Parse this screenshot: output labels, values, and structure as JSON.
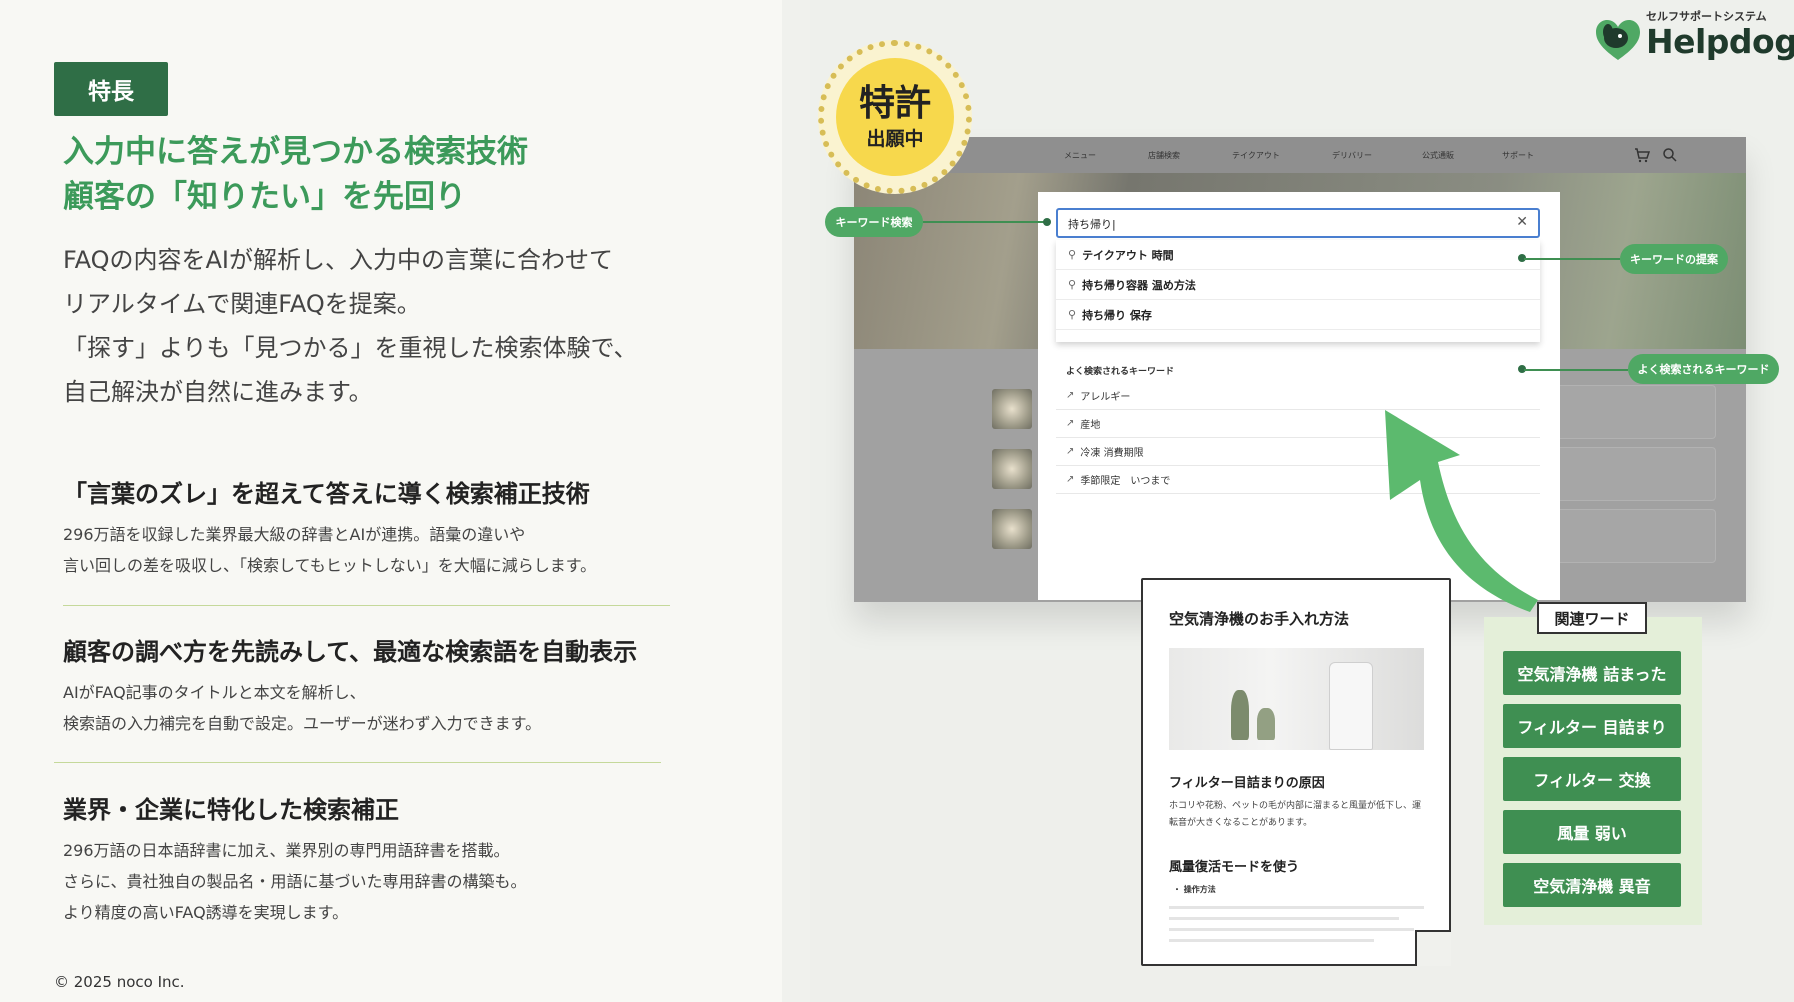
{
  "left": {
    "badge": "特長",
    "headline_1": "入力中に答えが見つかる検索技術",
    "headline_2": "顧客の「知りたい」を先回り",
    "lead_1": "FAQの内容をAIが解析し、入力中の言葉に合わせて",
    "lead_2": "リアルタイムで関連FAQを提案。",
    "lead_3": "「探す」よりも「見つかる」を重視した検索体験で、",
    "lead_4": "自己解決が自然に進みます。",
    "features": [
      {
        "title": "「言葉のズレ」を超えて答えに導く検索補正技術",
        "line_1": "296万語を収録した業界最大級の辞書とAIが連携。語彙の違いや",
        "line_2": "言い回しの差を吸収し、「検索してもヒットしない」を大幅に減らします。"
      },
      {
        "title": "顧客の調べ方を先読みして、最適な検索語を自動表示",
        "line_1": "AIがFAQ記事のタイトルと本文を解析し、",
        "line_2": "検索語の入力補完を自動で設定。ユーザーが迷わず入力できます。"
      },
      {
        "title": "業界・企業に特化した検索補正",
        "line_1": "296万語の日本語辞書に加え、業界別の専門用語辞書を搭載。",
        "line_2": "さらに、貴社独自の製品名・用語に基づいた専用辞書の構築も。",
        "line_3": "より精度の高いFAQ誘導を実現します。"
      }
    ],
    "copyright": "© 2025 noco Inc."
  },
  "logo": {
    "sub": "セルフサポートシステム",
    "main": "Helpdog",
    "icon": "dog-heart-icon"
  },
  "medal": {
    "main": "特許",
    "sub": "出願中"
  },
  "browser": {
    "nav": [
      "メニュー",
      "店舗検索",
      "テイクアウト",
      "デリバリー",
      "公式通販",
      "サポート"
    ],
    "icons": [
      "cart-icon",
      "search-icon"
    ]
  },
  "search": {
    "value": "持ち帰り|",
    "suggestions": [
      "テイクアウト 時間",
      "持ち帰り容器 温め方法",
      "持ち帰り 保存"
    ],
    "popular_title": "よく検索されるキーワード",
    "popular": [
      "アレルギー",
      "産地",
      "冷凍 消費期限",
      "季節限定　いつまで"
    ]
  },
  "tags": {
    "keyword_search": "キーワード検索",
    "keyword_suggest": "キーワードの提案",
    "popular_keywords": "よく検索されるキーワード"
  },
  "doc": {
    "title": "空気清浄機のお手入れ方法",
    "h2": "フィルター目詰まりの原因",
    "p": "ホコリや花粉、ペットの毛が内部に溜まると風量が低下し、運転音が大きくなることがあります。",
    "h3": "風量復活モードを使う",
    "li": "・ 操作方法"
  },
  "related": {
    "title": "関連ワード",
    "words": [
      "空気清浄機 詰まった",
      "フィルター 目詰まり",
      "フィルター 交換",
      "風量 弱い",
      "空気清浄機 異音"
    ]
  },
  "colors": {
    "brand_green": "#2f6e46",
    "accent_green": "#3c9a5a",
    "medal_yellow": "#f7d84c"
  }
}
